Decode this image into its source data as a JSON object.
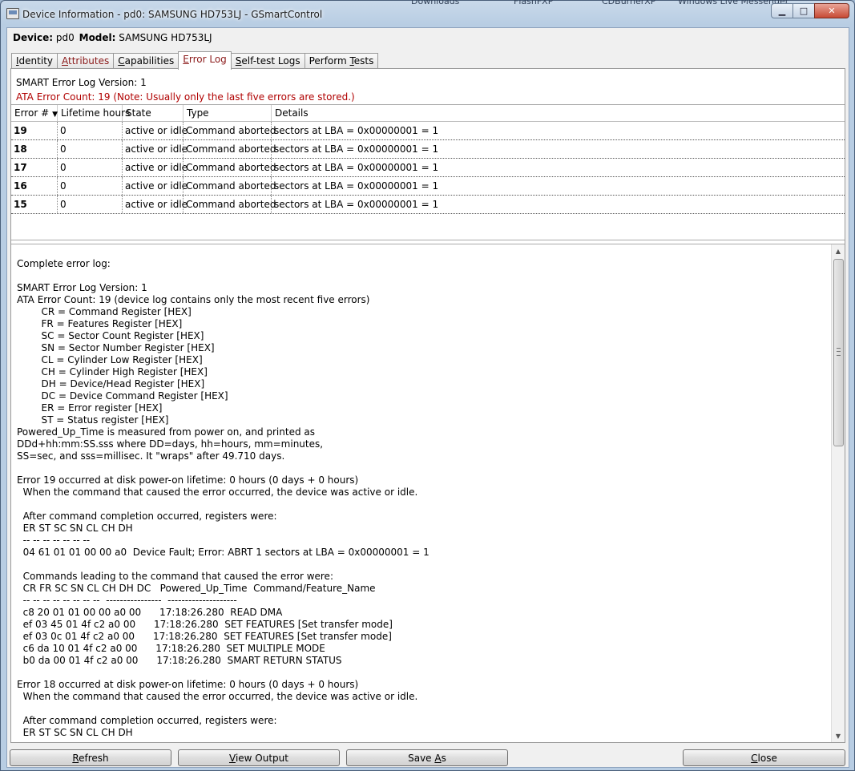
{
  "window": {
    "title": "Device Information - pd0: SAMSUNG HD753LJ - GSmartControl",
    "background_taskbar": [
      "Downloads",
      "FlashFXP",
      "CDBurnerXP",
      "Windows Live Messenger"
    ]
  },
  "header": {
    "device_label": "Device:",
    "device_value": "pd0",
    "model_label": "Model:",
    "model_value": "SAMSUNG HD753LJ"
  },
  "tabs": [
    {
      "pre": "",
      "mnemonic": "I",
      "post": "dentity"
    },
    {
      "pre": "",
      "mnemonic": "A",
      "post": "ttributes"
    },
    {
      "pre": "",
      "mnemonic": "C",
      "post": "apabilities"
    },
    {
      "pre": "",
      "mnemonic": "E",
      "post": "rror Log"
    },
    {
      "pre": "",
      "mnemonic": "S",
      "post": "elf-test Logs"
    },
    {
      "pre": "Perform ",
      "mnemonic": "T",
      "post": "ests"
    }
  ],
  "error_log": {
    "version_line": "SMART Error Log Version: 1",
    "count_line": "ATA Error Count: 19 (Note: Usually only the last five errors are stored.)",
    "columns": [
      "Error #",
      "Lifetime hours",
      "State",
      "Type",
      "Details"
    ],
    "rows": [
      {
        "num": "19",
        "hours": "0",
        "state": "active or idle",
        "type": "Command aborted",
        "details": "sectors at LBA = 0x00000001 = 1"
      },
      {
        "num": "18",
        "hours": "0",
        "state": "active or idle",
        "type": "Command aborted",
        "details": "sectors at LBA = 0x00000001 = 1"
      },
      {
        "num": "17",
        "hours": "0",
        "state": "active or idle",
        "type": "Command aborted",
        "details": "sectors at LBA = 0x00000001 = 1"
      },
      {
        "num": "16",
        "hours": "0",
        "state": "active or idle",
        "type": "Command aborted",
        "details": "sectors at LBA = 0x00000001 = 1"
      },
      {
        "num": "15",
        "hours": "0",
        "state": "active or idle",
        "type": "Command aborted",
        "details": "sectors at LBA = 0x00000001 = 1"
      }
    ],
    "complete_log": "Complete error log:\n\nSMART Error Log Version: 1\nATA Error Count: 19 (device log contains only the most recent five errors)\n        CR = Command Register [HEX]\n        FR = Features Register [HEX]\n        SC = Sector Count Register [HEX]\n        SN = Sector Number Register [HEX]\n        CL = Cylinder Low Register [HEX]\n        CH = Cylinder High Register [HEX]\n        DH = Device/Head Register [HEX]\n        DC = Device Command Register [HEX]\n        ER = Error register [HEX]\n        ST = Status register [HEX]\nPowered_Up_Time is measured from power on, and printed as\nDDd+hh:mm:SS.sss where DD=days, hh=hours, mm=minutes,\nSS=sec, and sss=millisec. It \"wraps\" after 49.710 days.\n\nError 19 occurred at disk power-on lifetime: 0 hours (0 days + 0 hours)\n  When the command that caused the error occurred, the device was active or idle.\n\n  After command completion occurred, registers were:\n  ER ST SC SN CL CH DH\n  -- -- -- -- -- -- --\n  04 61 01 01 00 00 a0  Device Fault; Error: ABRT 1 sectors at LBA = 0x00000001 = 1\n\n  Commands leading to the command that caused the error were:\n  CR FR SC SN CL CH DH DC   Powered_Up_Time  Command/Feature_Name\n  -- -- -- -- -- -- -- --  ----------------  --------------------\n  c8 20 01 01 00 00 a0 00      17:18:26.280  READ DMA\n  ef 03 45 01 4f c2 a0 00      17:18:26.280  SET FEATURES [Set transfer mode]\n  ef 03 0c 01 4f c2 a0 00      17:18:26.280  SET FEATURES [Set transfer mode]\n  c6 da 10 01 4f c2 a0 00      17:18:26.280  SET MULTIPLE MODE\n  b0 da 00 01 4f c2 a0 00      17:18:26.280  SMART RETURN STATUS\n\nError 18 occurred at disk power-on lifetime: 0 hours (0 days + 0 hours)\n  When the command that caused the error occurred, the device was active or idle.\n\n  After command completion occurred, registers were:\n  ER ST SC SN CL CH DH"
  },
  "buttons": {
    "refresh": {
      "pre": "",
      "mnemonic": "R",
      "post": "efresh"
    },
    "view_output": {
      "pre": "",
      "mnemonic": "V",
      "post": "iew Output"
    },
    "save_as": {
      "pre": "Save ",
      "mnemonic": "A",
      "post": "s"
    },
    "close": {
      "pre": "",
      "mnemonic": "C",
      "post": "lose"
    }
  }
}
